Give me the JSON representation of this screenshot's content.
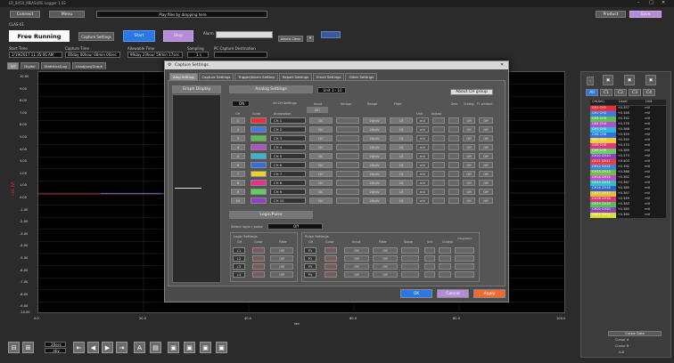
{
  "window": {
    "title": "LR_8450_MEASURE Logger 1.02"
  },
  "toolbar": {
    "connect_label": "Connect",
    "menu_label": "Menu",
    "status_message": "Play files by dropping here",
    "preferences_label": "Product",
    "save_label": "Save",
    "run_mode": "Free Running",
    "capture_settings_label": "Capture Settings",
    "start_label": "Start",
    "stop_label": "Stop",
    "alarm_label": "Alarm",
    "alarm_clear_label": "Alarm Clear",
    "device_id": "CLAS-01",
    "start_time_label": "Start Time",
    "start_time_value": "2/19/2017 11:35:06 AM",
    "capture_time_label": "Capture Time",
    "capture_time_value": "00day 00hour 00min 00sec",
    "allowable_time_label": "Allowable Time",
    "allowable_time_value": "99day 23hour 59min 17sec",
    "sampling_label": "Sampling",
    "sampling_value": "1 s",
    "pc_dest_label": "PC Capture Destination",
    "pc_dest_value": ""
  },
  "view_tabs": [
    "Y-T",
    "Digital",
    "Statistics/Log",
    "Lissajous/Graph"
  ],
  "graph": {
    "y_axis_label": "CH1 [V]",
    "y_ticks": [
      "10.00",
      "9.00",
      "8.00",
      "7.00",
      "6.00",
      "5.00",
      "4.00",
      "3.00",
      "2.00",
      "1.00",
      "0.00",
      "-1.00",
      "-2.00",
      "-3.00",
      "-4.00",
      "-5.00",
      "-6.00",
      "-7.00",
      "-8.00",
      "-9.00",
      "-10.00"
    ],
    "x_ticks": [
      "0.0",
      "20.0",
      "40.0",
      "60.0",
      "80.0",
      "100.0"
    ],
    "x_unit": "sec"
  },
  "dialog": {
    "title": "Capture Settings",
    "tabs": [
      "Amp Setting",
      "Capture Settings",
      "Trigger/Alarm Setting",
      "Report Settings",
      "Email Settings",
      "Other Settings"
    ],
    "graph_display_label": "Graph Display",
    "analog_settings_label": "Analog Settings",
    "unit_select": "Unit 1 - 10",
    "about_ch_group_label": "About CH group",
    "all_ch_settings_label": "All CH Settings",
    "all_ch_value": "ON",
    "all_input_value": "DC",
    "headers": {
      "ch": "CH",
      "color": "Color",
      "annotation": "Annotation",
      "input": "Input",
      "sensor": "Sensor",
      "range": "Range",
      "filter": "Filter",
      "unit": "Unit",
      "adjust": "Adjust",
      "scaling": "Scaling",
      "fft": "Fl. printout",
      "zero": "Zero"
    },
    "channels": [
      {
        "ch": "1",
        "color": "#e8303a",
        "annotation": "CH 1",
        "input": "DC",
        "range": "20mV",
        "filter": "10",
        "unit": "mV",
        "s": "Off",
        "p": "Off"
      },
      {
        "ch": "2",
        "color": "#3a7be8",
        "annotation": "CH 2",
        "input": "DC",
        "range": "20mV",
        "filter": "10",
        "unit": "mV",
        "s": "Off",
        "p": "Off"
      },
      {
        "ch": "3",
        "color": "#5ac04a",
        "annotation": "CH 3",
        "input": "DC",
        "range": "20mV",
        "filter": "10",
        "unit": "mV",
        "s": "Off",
        "p": "Off"
      },
      {
        "ch": "4",
        "color": "#b04fd0",
        "annotation": "CH 4",
        "input": "DC",
        "range": "20mV",
        "filter": "10",
        "unit": "mV",
        "s": "Off",
        "p": "Off"
      },
      {
        "ch": "5",
        "color": "#30b8d8",
        "annotation": "CH 5",
        "input": "DC",
        "range": "20mV",
        "filter": "10",
        "unit": "mV",
        "s": "Off",
        "p": "Off"
      },
      {
        "ch": "6",
        "color": "#3070e0",
        "annotation": "CH 6",
        "input": "DC",
        "range": "20mV",
        "filter": "10",
        "unit": "mV",
        "s": "Off",
        "p": "Off"
      },
      {
        "ch": "7",
        "color": "#f0d030",
        "annotation": "CH 7",
        "input": "DC",
        "range": "20mV",
        "filter": "10",
        "unit": "mV",
        "s": "Off",
        "p": "Off"
      },
      {
        "ch": "8",
        "color": "#e8308a",
        "annotation": "CH 8",
        "input": "DC",
        "range": "20mV",
        "filter": "10",
        "unit": "mV",
        "s": "Off",
        "p": "Off"
      },
      {
        "ch": "9",
        "color": "#60d060",
        "annotation": "CH 9",
        "input": "DC",
        "range": "20mV",
        "filter": "10",
        "unit": "mV",
        "s": "Off",
        "p": "Off"
      },
      {
        "ch": "10",
        "color": "#9040c8",
        "annotation": "CH 10",
        "input": "DC",
        "range": "20mV",
        "filter": "10",
        "unit": "mV",
        "s": "Off",
        "p": "Off"
      }
    ],
    "logic_pulse_label": "Logic/Pulse",
    "select_logic_label": "Select logic / pulse",
    "select_logic_value": "Off",
    "logic_settings_label": "Logic Settings",
    "pulse_settings_label": "Pulse Settings",
    "logic_headers": {
      "ch": "CH",
      "color": "Color",
      "filter": "Filter"
    },
    "pulse_headers": {
      "ch": "CH",
      "color": "Color",
      "input": "Input",
      "filter": "Filter",
      "slope": "Slope",
      "unit": "Unit",
      "scaling": "Scaling",
      "integ": "Integration"
    },
    "logic_rows": [
      {
        "ch": "L1",
        "filter": "Off"
      },
      {
        "ch": "L2",
        "filter": "Off"
      },
      {
        "ch": "L3",
        "filter": "Off"
      },
      {
        "ch": "L4",
        "filter": "Off"
      }
    ],
    "pulse_rows": [
      {
        "ch": "P1",
        "input": "Off",
        "filter": "Off"
      },
      {
        "ch": "P2",
        "input": "Off",
        "filter": "Off"
      },
      {
        "ch": "P3",
        "input": "Off",
        "filter": "Off"
      },
      {
        "ch": "P4",
        "input": "Off",
        "filter": "Off"
      }
    ],
    "ok_label": "OK",
    "cancel_label": "Cancel",
    "apply_label": "Apply"
  },
  "right_panel": {
    "tabs": [
      "All",
      "C1",
      "C2",
      "C3",
      "C4"
    ],
    "headers": {
      "ch": "CH(Anl)",
      "level": "Level",
      "unit": "Unit"
    },
    "rows": [
      {
        "ch": "CH1 CH1",
        "level": "+0.357",
        "unit": "mV",
        "color": "#e8303a"
      },
      {
        "ch": "CH2 CH2",
        "level": "+0.348",
        "unit": "mV",
        "color": "#3a7be8"
      },
      {
        "ch": "CH3 CH3",
        "level": "+0.352",
        "unit": "mV",
        "color": "#5ac04a"
      },
      {
        "ch": "CH4 CH4",
        "level": "+0.376",
        "unit": "mV",
        "color": "#b04fd0"
      },
      {
        "ch": "CH5 CH5",
        "level": "+0.368",
        "unit": "mV",
        "color": "#30b8d8"
      },
      {
        "ch": "CH6 CH6",
        "level": "+0.359",
        "unit": "mV",
        "color": "#3070e0"
      },
      {
        "ch": "CH7 CH7",
        "level": "+0.355",
        "unit": "mV",
        "color": "#f0d030"
      },
      {
        "ch": "CH8 CH8",
        "level": "+0.370",
        "unit": "mV",
        "color": "#e8308a"
      },
      {
        "ch": "CH9 CH9",
        "level": "+0.389",
        "unit": "mV",
        "color": "#60d060"
      },
      {
        "ch": "CH10 CH10",
        "level": "+0.373",
        "unit": "mV",
        "color": "#9040c8"
      },
      {
        "ch": "CH11 CH11",
        "level": "+0.403",
        "unit": "mV",
        "color": "#e84040"
      },
      {
        "ch": "CH12 CH12",
        "level": "+0.392",
        "unit": "mV",
        "color": "#4080e0"
      },
      {
        "ch": "CH13 CH13",
        "level": "+0.366",
        "unit": "mV",
        "color": "#70c040"
      },
      {
        "ch": "CH14 CH14",
        "level": "+0.362",
        "unit": "mV",
        "color": "#c050d0"
      },
      {
        "ch": "CH15 CH15",
        "level": "+0.367",
        "unit": "mV",
        "color": "#30c0c0"
      },
      {
        "ch": "CH16 CH16",
        "level": "+0.365",
        "unit": "mV",
        "color": "#3060d0"
      },
      {
        "ch": "CH17 CH17",
        "level": "+0.367",
        "unit": "mV",
        "color": "#e0c030"
      },
      {
        "ch": "CH18 CH18",
        "level": "+0.349",
        "unit": "mV",
        "color": "#e03080"
      },
      {
        "ch": "CH19 CH19",
        "level": "+0.383",
        "unit": "mV",
        "color": "#50c050"
      },
      {
        "ch": "CH20 CH20",
        "level": "+0.385",
        "unit": "mV",
        "color": "#9040c0"
      },
      {
        "ch": "CH21 CH21",
        "level": "+0.360",
        "unit": "mV",
        "color": "#d8e030"
      }
    ],
    "cursor_label": "Cursor Data",
    "cursor_a": "Cursor A",
    "cursor_b": "Cursor B",
    "cursor_ab": "A-B"
  },
  "bottom": {
    "time_div_value": "20sec",
    "time_div_sub": "/div"
  }
}
